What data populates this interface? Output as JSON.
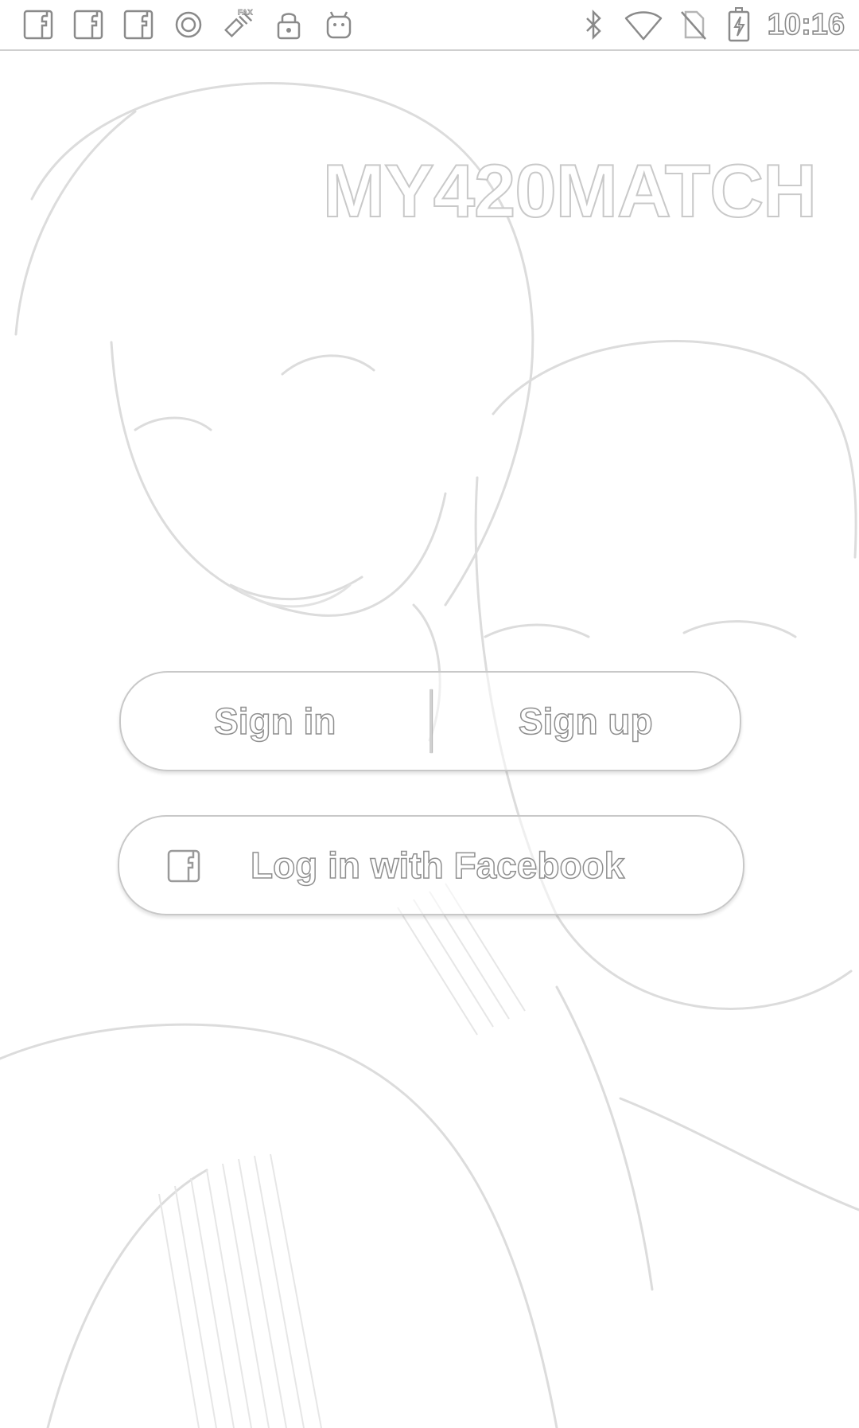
{
  "status_bar": {
    "left_icons": [
      "facebook-icon",
      "facebook-icon",
      "facebook-icon",
      "circle-notification-icon",
      "fax-app-icon",
      "lock-icon",
      "android-icon"
    ],
    "right_icons": [
      "bluetooth-icon",
      "wifi-icon",
      "no-sim-icon",
      "battery-charging-icon"
    ],
    "time": "10:16"
  },
  "app": {
    "logo": "MY420MATCH"
  },
  "auth": {
    "sign_in_label": "Sign in",
    "sign_up_label": "Sign up"
  },
  "facebook": {
    "label": "Log in with Facebook",
    "icon": "facebook-icon"
  },
  "colors": {
    "outline": "#c8c8c8",
    "text_outline": "#8f8f8f",
    "background": "#ffffff"
  }
}
